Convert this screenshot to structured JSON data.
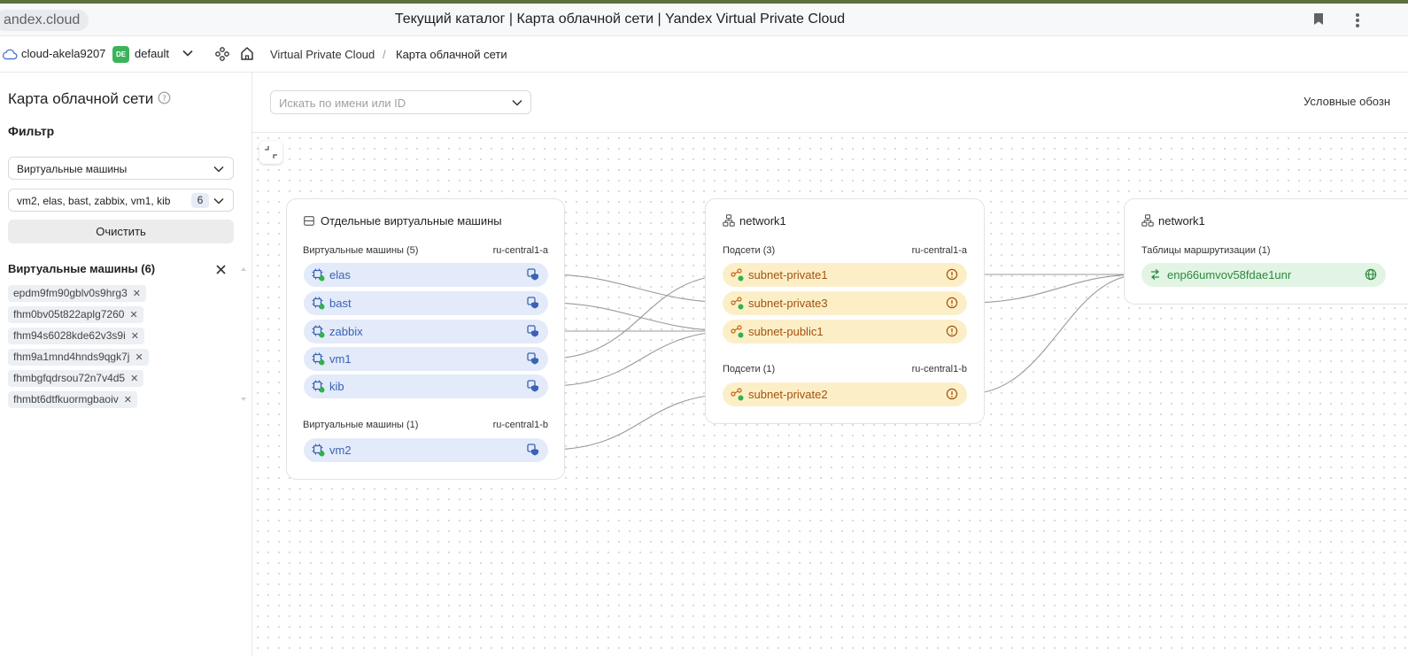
{
  "browser": {
    "url": "andex.cloud",
    "title": "Текущий каталог | Карта облачной сети | Yandex Virtual Private Cloud"
  },
  "header": {
    "cloud_name": "cloud-akela9207",
    "folder_badge": "DE",
    "folder_name": "default",
    "breadcrumb": [
      "Virtual Private Cloud",
      "Карта облачной сети"
    ],
    "breadcrumb_separator": "/"
  },
  "sidebar": {
    "title": "Карта облачной сети",
    "filter_label": "Фильтр",
    "resource_type": "Виртуальные машины",
    "selected_vms": "vm2, elas, bast, zabbix, vm1, kib",
    "selected_count": "6",
    "clear_button": "Очистить",
    "vm_section_title": "Виртуальные машины (6)",
    "vm_ids": [
      "epdm9fm90gblv0s9hrg3",
      "fhm0bv05t822aplg7260",
      "fhm94s6028kde62v3s9i",
      "fhm9a1mnd4hnds9qgk7j",
      "fhmbgfqdrsou72n7v4d5",
      "fhmbt6dtfkuormgbaoiv"
    ]
  },
  "toolbar": {
    "search_placeholder": "Искать по имени или ID",
    "legend_button": "Условные обозн"
  },
  "map": {
    "vm_group": {
      "title": "Отдельные виртуальные машины",
      "zone_a_label": "Виртуальные машины (5)",
      "zone_a": "ru-central1-a",
      "zone_a_vms": [
        "elas",
        "bast",
        "zabbix",
        "vm1",
        "kib"
      ],
      "zone_b_label": "Виртуальные машины (1)",
      "zone_b": "ru-central1-b",
      "zone_b_vms": [
        "vm2"
      ]
    },
    "network_group": {
      "title": "network1",
      "zone_a_label": "Подсети (3)",
      "zone_a": "ru-central1-a",
      "zone_a_subnets": [
        "subnet-private1",
        "subnet-private3",
        "subnet-public1"
      ],
      "zone_b_label": "Подсети (1)",
      "zone_b": "ru-central1-b",
      "zone_b_subnets": [
        "subnet-private2"
      ]
    },
    "route_group": {
      "title": "network1",
      "tables_label": "Таблицы маршрутизации (1)",
      "tables": [
        "enp66umvov58fdae1unr"
      ]
    },
    "links": [
      {
        "from": "elas",
        "to": "subnet-private3"
      },
      {
        "from": "bast",
        "to": "subnet-public1"
      },
      {
        "from": "zabbix",
        "to": "subnet-public1"
      },
      {
        "from": "vm1",
        "to": "subnet-private1"
      },
      {
        "from": "kib",
        "to": "subnet-public1"
      },
      {
        "from": "vm2",
        "to": "subnet-private2"
      },
      {
        "from": "subnet-private1",
        "to": "enp66umvov58fdae1unr"
      },
      {
        "from": "subnet-private3",
        "to": "enp66umvov58fdae1unr"
      },
      {
        "from": "subnet-private2",
        "to": "enp66umvov58fdae1unr"
      }
    ]
  },
  "colors": {
    "vm_bg": "#e3eaf9",
    "vm_text": "#3a63b4",
    "subnet_bg": "#fcefc8",
    "subnet_text": "#a4520e",
    "route_bg": "#e2f4e3",
    "route_text": "#2b8a3e",
    "status_ok": "#2fb34a",
    "folder_badge": "#3bb35a"
  }
}
